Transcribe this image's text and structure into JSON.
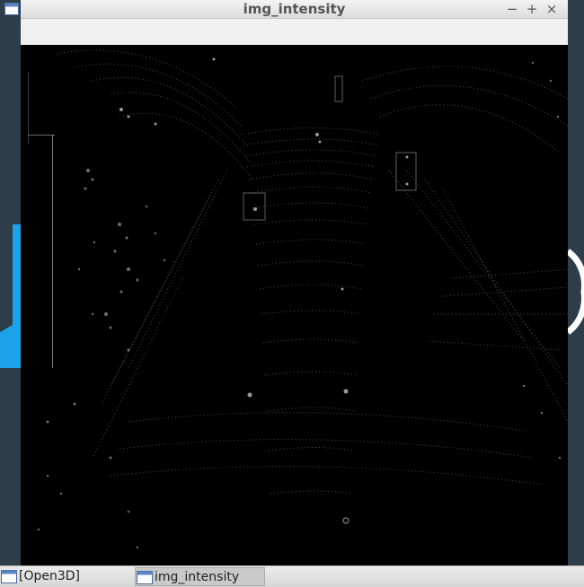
{
  "window": {
    "title": "img_intensity",
    "controls": {
      "minimize": "−",
      "maximize": "+",
      "close": "×"
    }
  },
  "viewport": {
    "content": "lidar-intensity-image",
    "background": "#000000"
  },
  "taskbar": {
    "items": [
      {
        "label": "[Open3D]",
        "active": false
      },
      {
        "label": "img_intensity",
        "active": true
      }
    ]
  },
  "colors": {
    "desktop": "#2e3d4a",
    "accent": "#1aa3e8",
    "titlebar": "#e6e6e6"
  }
}
